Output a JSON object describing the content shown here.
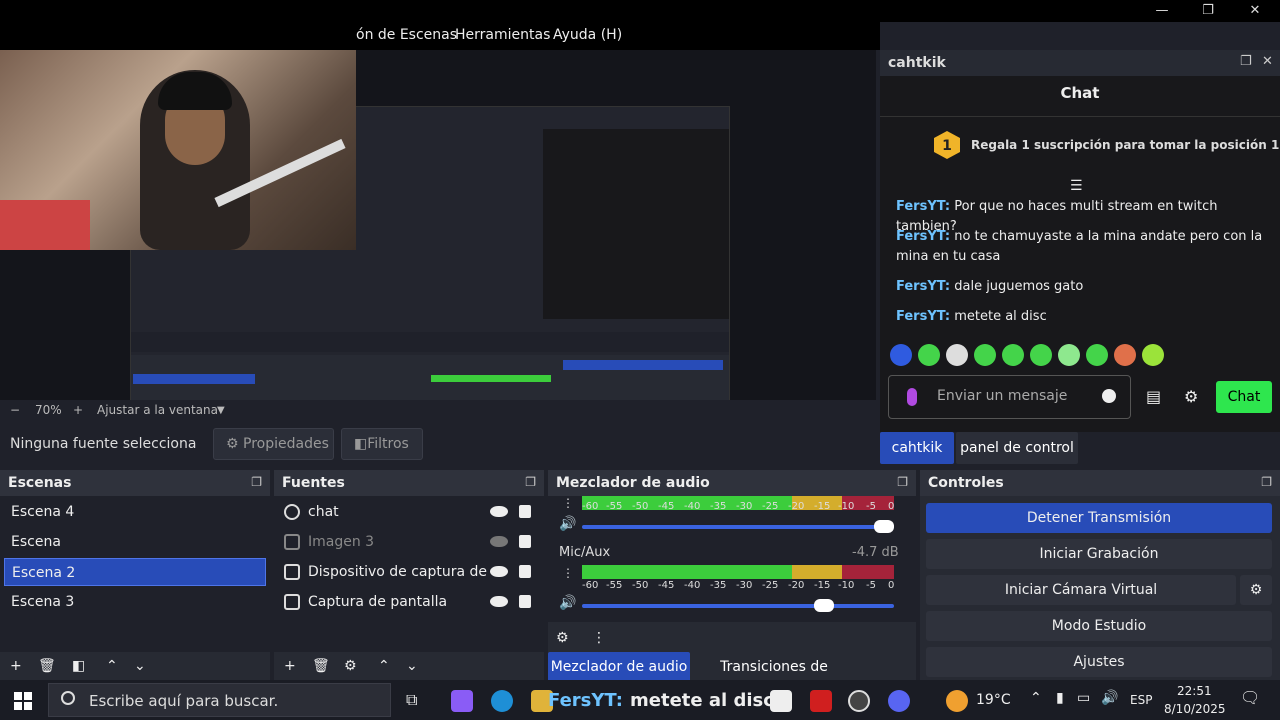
{
  "menubar": {
    "items": [
      "ón de Escenas",
      "Herramientas",
      "Ayuda (H)"
    ]
  },
  "window_controls": {
    "minimize": "—",
    "maximize": "❐",
    "close": "✕"
  },
  "zoom": {
    "minus": "−",
    "value": "70%",
    "plus": "+",
    "fit": "Ajustar a la ventana",
    "arrow": "▼"
  },
  "source_bar": {
    "label": "Ninguna fuente selecciona",
    "properties": "Propiedades",
    "filters": "Filtros"
  },
  "chat_dock": {
    "title": "cahtkik",
    "chat_header": "Chat",
    "gift_number": "1",
    "gift_text": "Regala 1 suscripción para tomar la posición 1",
    "messages": [
      {
        "user": "FersYT:",
        "text": "Por que no haces multi stream en twitch tambien?"
      },
      {
        "user": "FersYT:",
        "text": "no te chamuyaste a la mina andate pero con la mina en tu casa"
      },
      {
        "user": "FersYT:",
        "text": "dale juguemos gato"
      },
      {
        "user": "FersYT:",
        "text": "metete al disc"
      }
    ],
    "input_placeholder": "Enviar un mensaje",
    "send_label": "Chat"
  },
  "dock_tabs": [
    "cahtkik",
    "panel de control"
  ],
  "scenes": {
    "title": "Escenas",
    "items": [
      "Escena 4",
      "Escena",
      "Escena 2",
      "Escena 3"
    ],
    "selected": "Escena 2"
  },
  "sources": {
    "title": "Fuentes",
    "items": [
      "chat",
      "Imagen 3",
      "Dispositivo de captura de video",
      "Captura de pantalla"
    ]
  },
  "mixer": {
    "title": "Mezclador de audio",
    "ticks": [
      "-60",
      "-55",
      "-50",
      "-45",
      "-40",
      "-35",
      "-30",
      "-25",
      "-20",
      "-15",
      "-10",
      "-5",
      "0"
    ],
    "channel_name": "Mic/Aux",
    "channel_db": "-4.7 dB",
    "tabs": [
      "Mezclador de audio",
      "Transiciones de escena"
    ]
  },
  "controls": {
    "title": "Controles",
    "buttons": [
      "Detener Transmisión",
      "Iniciar Grabación",
      "Iniciar Cámara Virtual",
      "Modo Estudio",
      "Ajustes"
    ]
  },
  "taskbar": {
    "search_placeholder": "Escribe aquí para buscar.",
    "overlay_user": "FersYT:",
    "overlay_text": "metete al disc",
    "temperature": "19°C",
    "language": "ESP",
    "time": "22:51",
    "date": "8/10/2025"
  },
  "colors": {
    "accent": "#284cb8",
    "chat_send": "#2ee64e",
    "username": "#6ec3ff"
  }
}
